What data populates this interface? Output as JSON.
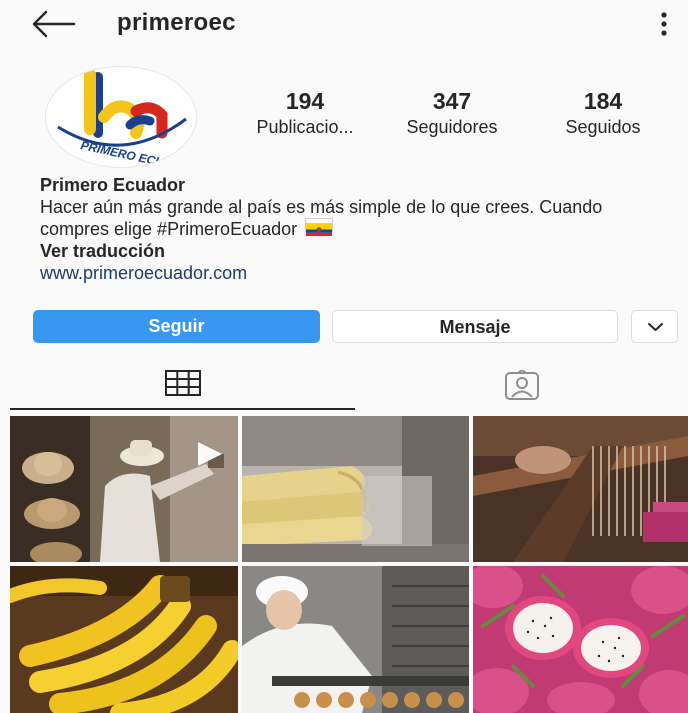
{
  "header": {
    "username": "primeroec",
    "back_icon": "arrow-left-icon",
    "menu_icon": "more-vertical-icon"
  },
  "profile": {
    "avatar_text": "PRIMERO ECUADOR",
    "stats": [
      {
        "value": "194",
        "label": "Publicacio..."
      },
      {
        "value": "347",
        "label": "Seguidores"
      },
      {
        "value": "184",
        "label": "Seguidos"
      }
    ]
  },
  "bio": {
    "name": "Primero Ecuador",
    "text": "Hacer aún más grande al país es más simple de lo que crees. Cuando compres elige #PrimeroEcuador",
    "translate": "Ver traducción",
    "link": "www.primeroecuador.com"
  },
  "actions": {
    "follow_label": "Seguir",
    "message_label": "Mensaje",
    "more_icon": "chevron-down-icon"
  },
  "tabs": {
    "grid_icon": "grid-icon",
    "tagged_icon": "tagged-person-icon"
  },
  "colors": {
    "accent": "#3897f0",
    "link": "#1e3a6b",
    "text": "#262626",
    "background": "#fafafa"
  },
  "posts": [
    {
      "subject": "hats-artisan",
      "video": true
    },
    {
      "subject": "pasta-strips",
      "video": false
    },
    {
      "subject": "loom-weaving",
      "video": false
    },
    {
      "subject": "bananas",
      "video": false
    },
    {
      "subject": "bakery-worker",
      "video": false
    },
    {
      "subject": "dragon-fruit",
      "video": false
    }
  ]
}
